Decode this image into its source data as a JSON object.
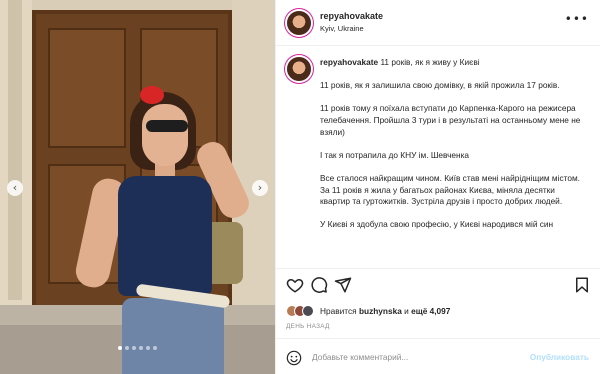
{
  "post": {
    "username": "repyahovakate",
    "location": "Kyiv, Ukraine",
    "more_icon": "more-horizontal-icon"
  },
  "caption": {
    "username": "repyahovakate",
    "title": "11 років, як я живу у Києві",
    "paragraphs": [
      "11 років, як я залишила свою домівку, в якій прожила 17 років.",
      "11 років тому я поїхала вступати до Карпенка-Карого на режисера телебачення. Пройшла 3 тури і в результаті на останньому мене не взяли)",
      "І так я потрапила до КНУ ім. Шевченка",
      "Все сталося найкращим чином. Київ став мені найрідніщим містом.",
      "За 11 років я жила у багатьох районах Києва, міняла десятки квартир та гуртожитків. Зустріла друзів і просто добрих людей.",
      "У Києві я здобула свою професію, у Києві народився мій син"
    ]
  },
  "photo": {
    "prev_label": "‹",
    "next_label": "›",
    "dots_count": 6,
    "active_dot": 0
  },
  "actions": {
    "like_icon": "heart-icon",
    "comment_icon": "comment-icon",
    "share_icon": "send-icon",
    "save_icon": "bookmark-icon"
  },
  "likes": {
    "prefix": "Нравится",
    "user": "buzhynska",
    "conjunction": "и",
    "more": "ещё 4,097"
  },
  "date": "ДЕНЬ НАЗАД",
  "comment": {
    "placeholder": "Добавьте комментарий...",
    "publish_label": "Опубликовать",
    "emoji_icon": "smiley-icon"
  },
  "colors": {
    "accent": "#0095f6",
    "publish_disabled": "#b2dffc",
    "muted": "#8e8e8e"
  }
}
